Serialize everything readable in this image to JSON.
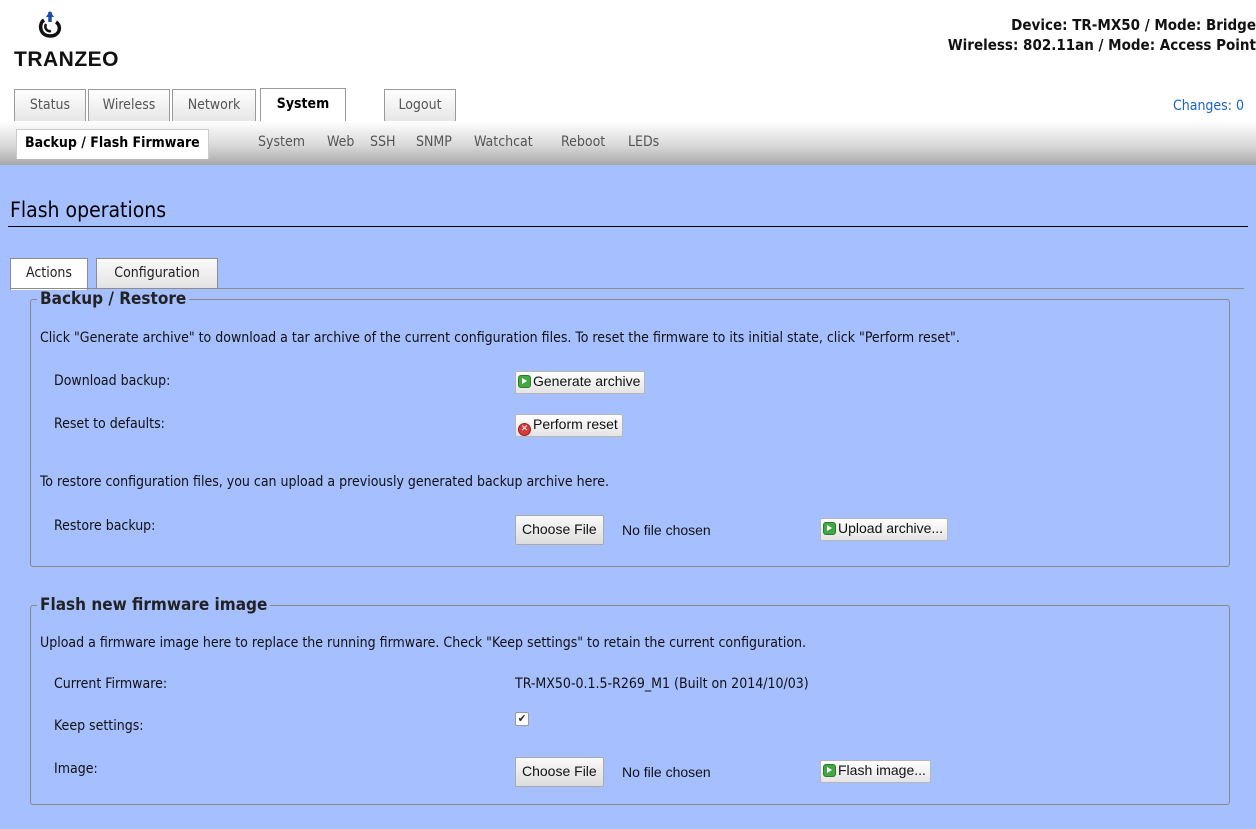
{
  "brand": {
    "logo_text": "TRANZEO"
  },
  "header": {
    "device_line": "Device: TR-MX50 / Mode: Bridge",
    "wireless_line": "Wireless: 802.11an / Mode: Access Point",
    "changes": "Changes: 0"
  },
  "main_tabs": [
    "Status",
    "Wireless",
    "Network",
    "System",
    "Logout"
  ],
  "sub_tabs": [
    "Backup / Flash Firmware",
    "System",
    "Web",
    "SSH",
    "SNMP",
    "Watchcat",
    "Reboot",
    "LEDs"
  ],
  "page": {
    "title": "Flash operations"
  },
  "content_tabs": [
    "Actions",
    "Configuration"
  ],
  "backup": {
    "legend": "Backup / Restore",
    "description": "Click \"Generate archive\" to download a tar archive of the current configuration files. To reset the firmware to its initial state, click \"Perform reset\".",
    "download_label": "Download backup:",
    "generate_button": "Generate archive",
    "reset_label": "Reset to defaults:",
    "reset_button": "Perform reset",
    "restore_note": "To restore configuration files, you can upload a previously generated backup archive here.",
    "restore_label": "Restore backup:",
    "choose_file": "Choose File",
    "no_file": "No file chosen",
    "upload_button": "Upload archive..."
  },
  "flash": {
    "legend": "Flash new firmware image",
    "description": "Upload a firmware image here to replace the running firmware. Check \"Keep settings\" to retain the current configuration.",
    "current_label": "Current Firmware:",
    "current_value": "TR-MX50-0.1.5-R269_M1 (Built on 2014/10/03)",
    "keep_label": "Keep settings:",
    "keep_checked": true,
    "image_label": "Image:",
    "choose_file": "Choose File",
    "no_file": "No file chosen",
    "flash_button": "Flash image..."
  },
  "colors": {
    "content_bg": "#a6bfff",
    "link": "#1a64c8"
  },
  "icons": {
    "go": "green-arrow-icon",
    "reset": "red-x-icon",
    "check": "checkmark-icon"
  }
}
